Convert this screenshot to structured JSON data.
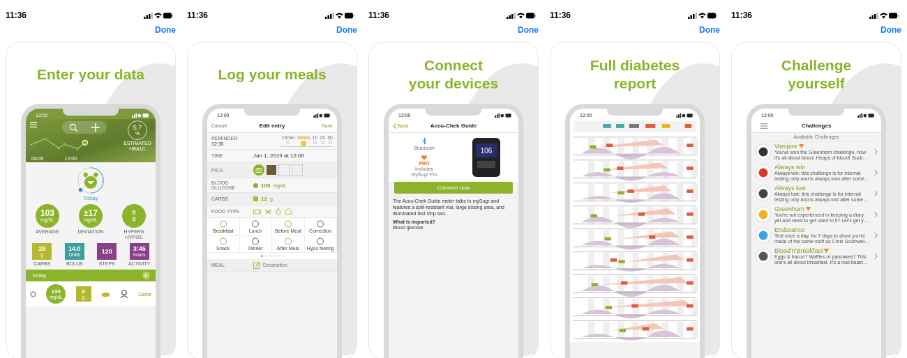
{
  "panels": [
    {
      "time": "11:36",
      "done": "Done",
      "title": [
        "Enter your data"
      ],
      "screen": {
        "kind": "dashboard",
        "time": "12:00",
        "chart_times": [
          "06:00",
          "12:00"
        ],
        "hba1c": {
          "value": "5,7",
          "unit": "%",
          "label": "ESTIMATED HBA1C"
        },
        "today": "Today",
        "stats": [
          {
            "value": "103",
            "unit": "mg/dL",
            "label": "AVERAGE"
          },
          {
            "value": "±17",
            "unit": "mg/dL",
            "label": "DEVIATION"
          },
          {
            "value": "0",
            "value2": "0",
            "label": "HYPERS HYPOS"
          }
        ],
        "tiles": [
          {
            "value": "28",
            "unit": "g",
            "label": "CARBS",
            "color": "#b4b82c"
          },
          {
            "value": "14.0",
            "unit": "Units",
            "label": "BOLUS",
            "color": "#3e9f9c"
          },
          {
            "value": "120",
            "label": "STEPS",
            "color": "#8b3f8b"
          },
          {
            "value": "3:45",
            "unit": "hours",
            "label": "ACTIVITY",
            "color": "#8b3f8b"
          }
        ],
        "day": "Today",
        "entry": {
          "glucose": "130",
          "glucose_unit": "mg/dL",
          "carbs": "8",
          "carbs_unit": "g",
          "note": "Carbs"
        }
      }
    },
    {
      "time": "11:36",
      "done": "Done",
      "title": [
        "Log your meals"
      ],
      "screen": {
        "kind": "edit",
        "time": "12:00",
        "cancel": "Cancel",
        "title": "Edit entry",
        "save": "Save",
        "reminder": {
          "label": "REMINDER",
          "value": "12:30",
          "stops": [
            {
              "label": "15min",
              "selected": false
            },
            {
              "label": "30min",
              "selected": true
            },
            {
              "label": "1h",
              "selected": false
            },
            {
              "label": "2h",
              "selected": false
            },
            {
              "label": "3h",
              "selected": false
            }
          ]
        },
        "rows": [
          {
            "kind": "text",
            "label": "TIME",
            "value": "Jan 1, 2019 at 12:00"
          },
          {
            "kind": "pics",
            "label": "PICS"
          },
          {
            "kind": "glucose",
            "label": "BLOOD GLUCOSE",
            "value": "100",
            "unit": "mg/dL"
          },
          {
            "kind": "carbs",
            "label": "CARBS",
            "value": "12",
            "unit": "g"
          },
          {
            "kind": "food",
            "label": "FOOD TYPE"
          }
        ],
        "tags": [
          "Breakfast",
          "Lunch",
          "Before Meal",
          "Correction",
          "Snack",
          "Dinner",
          "After Meal",
          "Hypo feeling"
        ],
        "pages": [
          {
            "selected": true
          },
          {
            "selected": false
          },
          {
            "selected": false
          },
          {
            "selected": false
          },
          {
            "selected": false
          },
          {
            "selected": false
          }
        ],
        "meal": {
          "label": "MEAL",
          "placeholder": "Description"
        }
      }
    },
    {
      "time": "11:36",
      "done": "Done",
      "title": [
        "Connect",
        "your devices"
      ],
      "screen": {
        "kind": "device",
        "time": "12:00",
        "back": "Back",
        "title": "Accu-Chek Guide",
        "features": [
          {
            "kind": "bluetooth",
            "label": "Bluetooth"
          },
          {
            "kind": "pro",
            "badge": "PRO",
            "label": "Includes mySugr Pro"
          }
        ],
        "reading": "106",
        "button": "Connect now",
        "description": "The Accu-Chek Guide meter talks to mySugr and features a spill-resistant vial, large dosing area, and illuminated test strip slot.",
        "question": "What is imported?",
        "answer": "Blood glucose"
      }
    },
    {
      "time": "11:36",
      "done": "Done",
      "title": [
        "Full diabetes",
        "report"
      ],
      "screen": {
        "kind": "report",
        "time": "12:00"
      }
    },
    {
      "time": "11:36",
      "done": "Done",
      "title": [
        "Challenge",
        "yourself"
      ],
      "screen": {
        "kind": "challenges",
        "time": "12:00",
        "title": "Challenges",
        "section": "Available Challenges",
        "items": [
          {
            "name": "Vampire",
            "won": true,
            "text": "You've won the Greenhorn challenge, now it's all about blood. Heaps of blood! Suck…"
          },
          {
            "name": "Always win",
            "won": false,
            "text": "Always win: this challenge is for internal testing only and is always won after some…"
          },
          {
            "name": "Always lost",
            "won": false,
            "text": "Always lost: this challenge is for internal testing only and is always lost after some…"
          },
          {
            "name": "Greenhorn",
            "won": true,
            "text": "You're not experienced in keeping a diary yet and need to get used to it? Let's get y…"
          },
          {
            "name": "Endurance",
            "won": false,
            "text": "Test once a day, for 7 days to show you're made of the same stuff as Chris Southwel…"
          },
          {
            "name": "Blood'n'Breakfast",
            "won": true,
            "text": "Eggs & bacon? Waffles or pancakes? This one's all about breakfast. It's a real beast…"
          }
        ]
      }
    }
  ]
}
